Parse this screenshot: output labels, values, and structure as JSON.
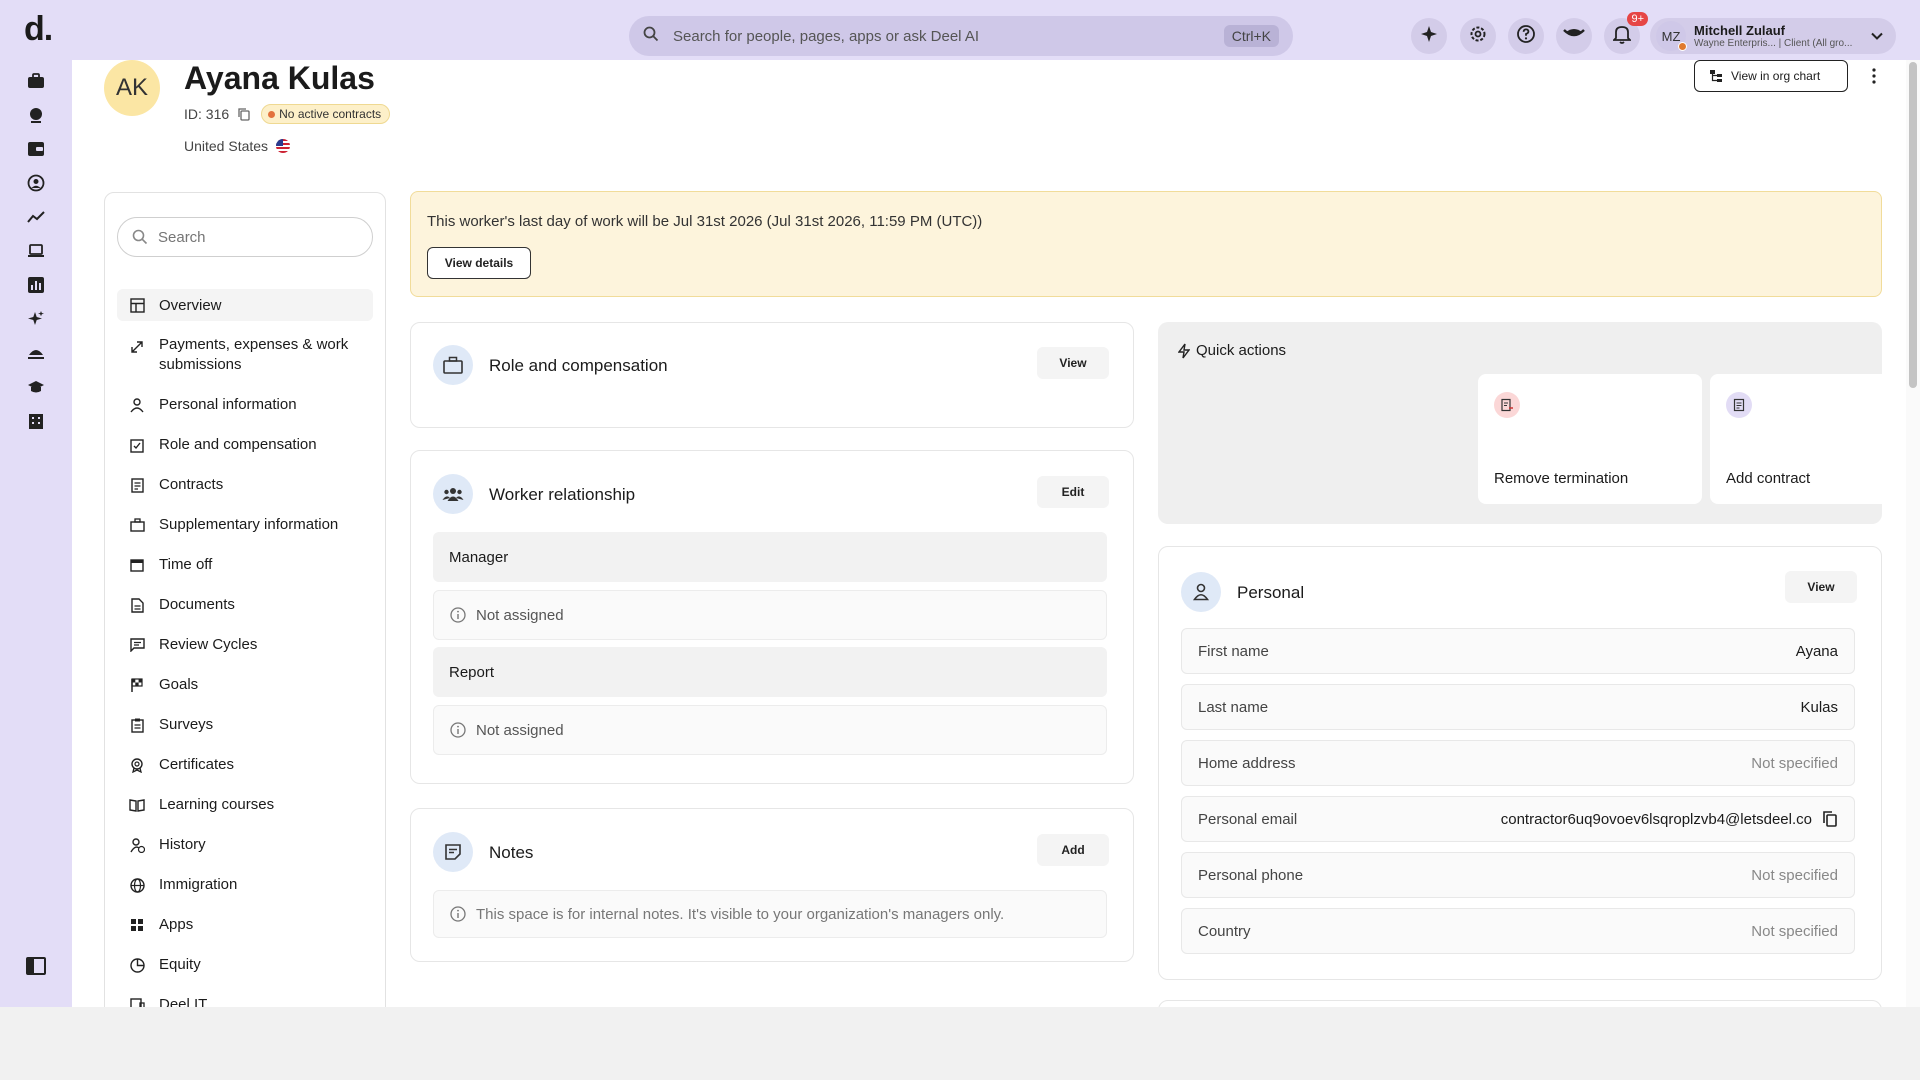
{
  "topbar": {
    "logo": "d.",
    "search_placeholder": "Search for people, pages, apps or ask Deel AI",
    "shortcut": "Ctrl+K",
    "notifications_badge": "9+",
    "account": {
      "initials": "MZ",
      "name": "Mitchell Zulauf",
      "subtitle": "Wayne Enterpris... | Client (All gro..."
    }
  },
  "profile": {
    "initials": "AK",
    "name": "Ayana Kulas",
    "id_label": "ID: 316",
    "status": "No active contracts",
    "country": "United States",
    "org_chart_button": "View in org chart"
  },
  "sidenav": {
    "search_placeholder": "Search",
    "items": [
      {
        "label": "Overview"
      },
      {
        "label": "Payments, expenses & work submissions"
      },
      {
        "label": "Personal information"
      },
      {
        "label": "Role and compensation"
      },
      {
        "label": "Contracts"
      },
      {
        "label": "Supplementary information"
      },
      {
        "label": "Time off"
      },
      {
        "label": "Documents"
      },
      {
        "label": "Review Cycles"
      },
      {
        "label": "Goals"
      },
      {
        "label": "Surveys"
      },
      {
        "label": "Certificates"
      },
      {
        "label": "Learning courses"
      },
      {
        "label": "History"
      },
      {
        "label": "Immigration"
      },
      {
        "label": "Apps"
      },
      {
        "label": "Equity"
      },
      {
        "label": "Deel IT"
      }
    ]
  },
  "banner": {
    "text": "This worker's last day of work will be Jul 31st 2026 (Jul 31st 2026, 11:59 PM (UTC))",
    "button": "View details"
  },
  "role_card": {
    "title": "Role and compensation",
    "button": "View"
  },
  "relationship_card": {
    "title": "Worker relationship",
    "button": "Edit",
    "manager_label": "Manager",
    "manager_value": "Not assigned",
    "report_label": "Report",
    "report_value": "Not assigned"
  },
  "notes_card": {
    "title": "Notes",
    "button": "Add",
    "hint": "This space is for internal notes. It's visible to your organization's managers only."
  },
  "quick_actions": {
    "title": "Quick actions",
    "tiles": [
      {
        "label": "Remove termination",
        "icon": "remove-termination-icon",
        "color": "#fbd7d7"
      },
      {
        "label": "Add contract",
        "icon": "add-contract-icon",
        "color": "#e2dcf5"
      }
    ]
  },
  "personal_card": {
    "title": "Personal",
    "button": "View",
    "fields": [
      {
        "label": "First name",
        "value": "Ayana"
      },
      {
        "label": "Last name",
        "value": "Kulas"
      },
      {
        "label": "Home address",
        "value": "Not specified"
      },
      {
        "label": "Personal email",
        "value": "contractor6uq9ovoev6lsqroplzvb4@letsdeel.co"
      },
      {
        "label": "Personal phone",
        "value": "Not specified"
      },
      {
        "label": "Country",
        "value": "Not specified"
      }
    ]
  }
}
